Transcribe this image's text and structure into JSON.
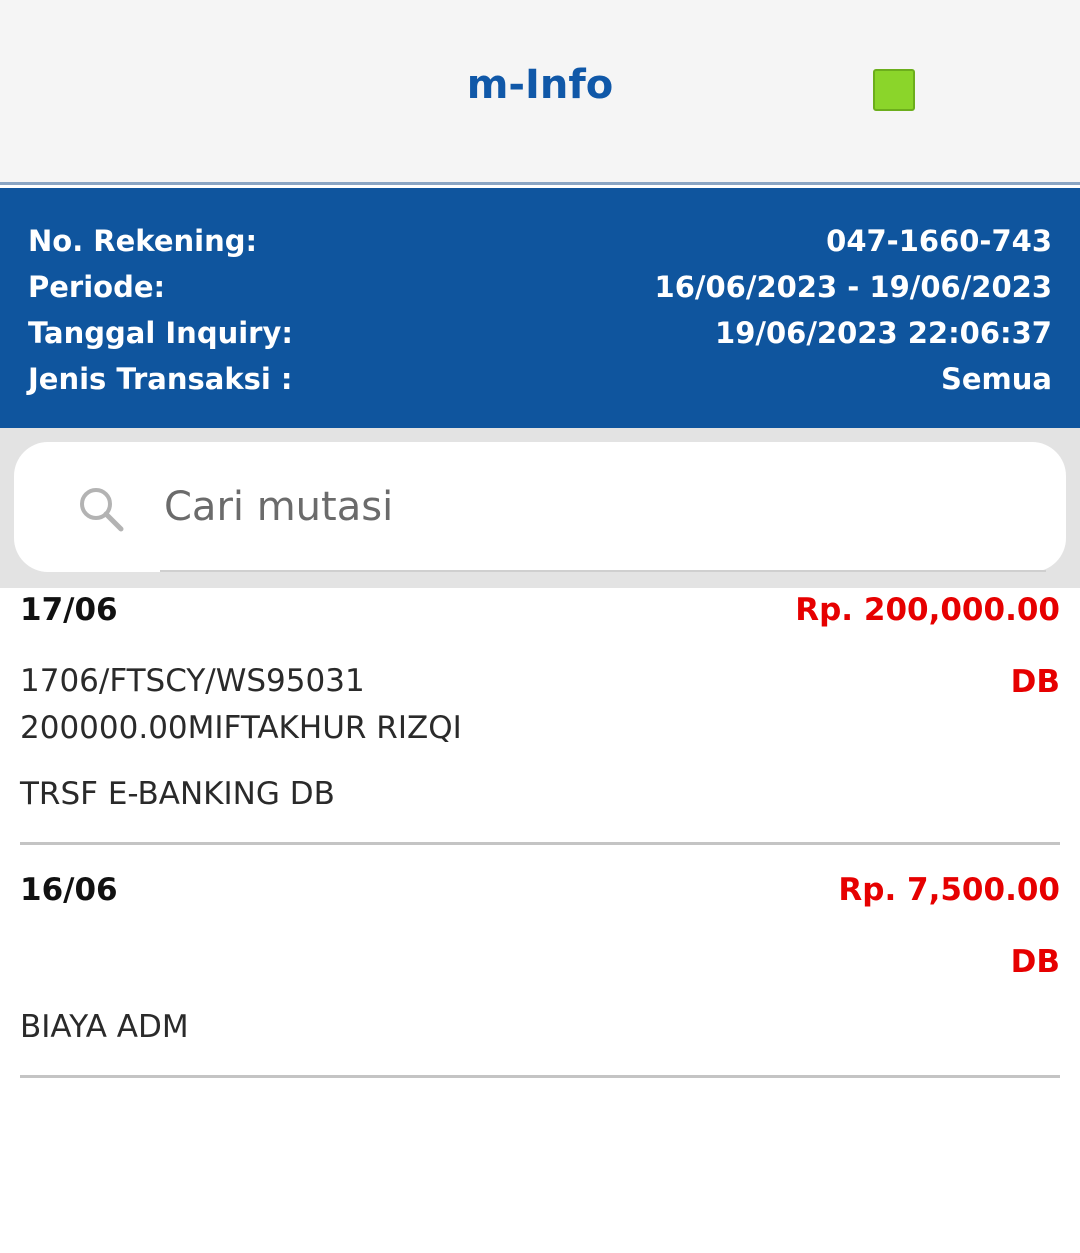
{
  "header": {
    "title": "m-Info"
  },
  "account_info": {
    "rows": [
      {
        "label": "No. Rekening:",
        "value": "047-1660-743"
      },
      {
        "label": "Periode:",
        "value": "16/06/2023 - 19/06/2023"
      },
      {
        "label": "Tanggal Inquiry:",
        "value": "19/06/2023 22:06:37"
      },
      {
        "label": "Jenis Transaksi :",
        "value": "Semua"
      }
    ]
  },
  "search": {
    "placeholder": "Cari mutasi"
  },
  "transactions": [
    {
      "date": "17/06",
      "amount": "Rp. 200,000.00",
      "debit_credit": "DB",
      "description": "1706/FTSCY/WS95031\n200000.00MIFTAKHUR RIZQI",
      "type": "TRSF E-BANKING DB"
    },
    {
      "date": "16/06",
      "amount": "Rp. 7,500.00",
      "debit_credit": "DB",
      "description": "",
      "type": "BIAYA ADM"
    }
  ],
  "colors": {
    "brand_blue": "#0f559e",
    "title_blue": "#1058a8",
    "amount_red": "#e60000",
    "status_green": "#8bd52a"
  },
  "icons": {
    "search": "search-icon",
    "status": "status-square-icon"
  }
}
